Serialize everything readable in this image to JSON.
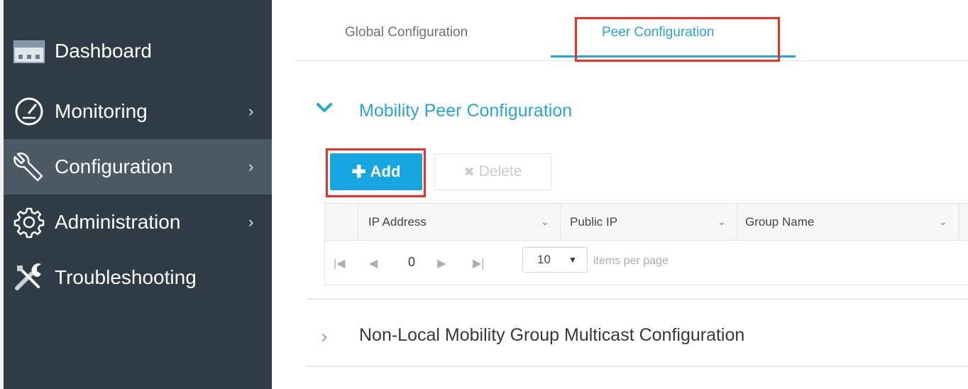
{
  "sidebar": {
    "items": [
      {
        "label": "Dashboard",
        "icon": "dashboard-icon",
        "has_chevron": false
      },
      {
        "label": "Monitoring",
        "icon": "gauge-icon",
        "has_chevron": true
      },
      {
        "label": "Configuration",
        "icon": "wrench-icon",
        "has_chevron": true,
        "active": true
      },
      {
        "label": "Administration",
        "icon": "gear-icon",
        "has_chevron": true
      },
      {
        "label": "Troubleshooting",
        "icon": "tools-icon",
        "has_chevron": false
      }
    ],
    "chevron": "›"
  },
  "tabs": [
    {
      "label": "Global Configuration"
    },
    {
      "label": "Peer Configuration",
      "active": true
    }
  ],
  "section": {
    "title": "Mobility Peer Configuration",
    "expanded": true
  },
  "actions": {
    "add_label": "Add",
    "delete_label": "Delete"
  },
  "grid": {
    "columns": [
      "IP Address",
      "Public IP",
      "Group Name"
    ],
    "pager": {
      "page": "0",
      "page_size": "10",
      "items_per_page_text": "items per page"
    }
  },
  "section2": {
    "title": "Non-Local Mobility Group Multicast Configuration",
    "expanded": false
  },
  "colors": {
    "accent": "#2aa6d6",
    "sidebar_bg": "#2f3b45",
    "highlight": "#ee3024",
    "add_button": "#16a7e0"
  }
}
